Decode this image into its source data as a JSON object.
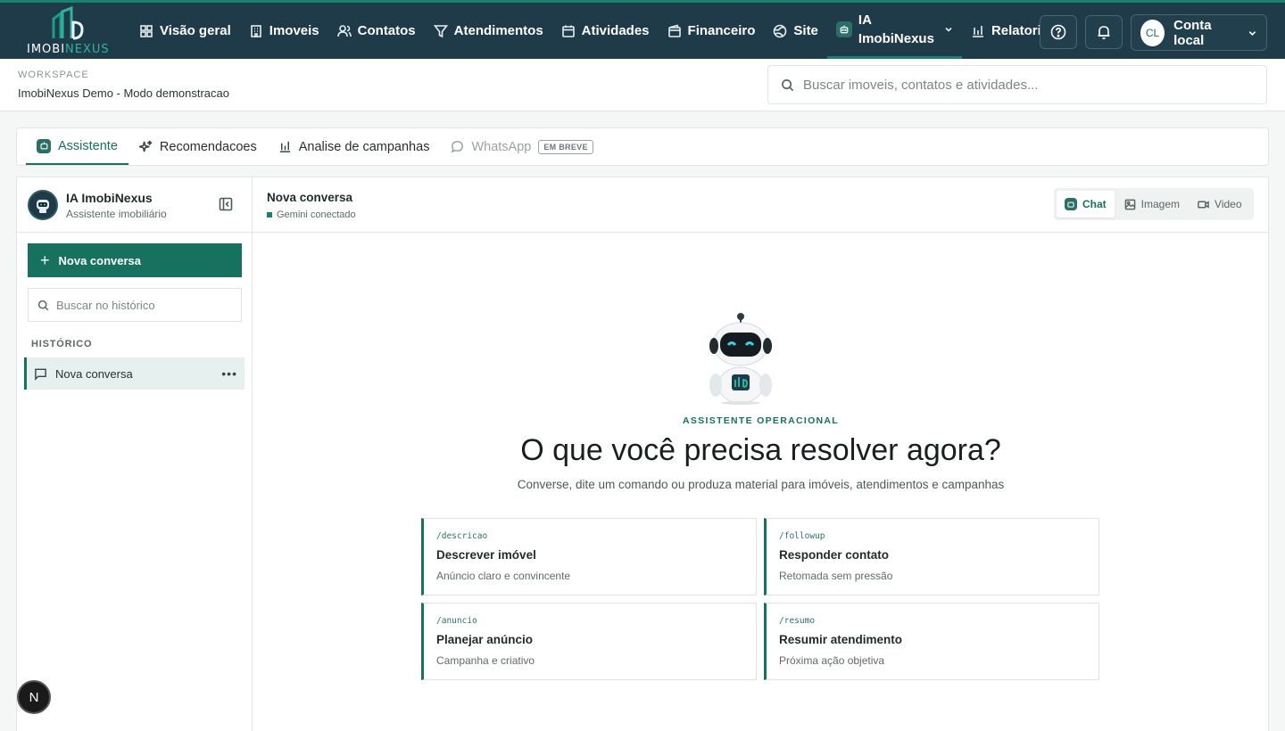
{
  "brand": {
    "word_a": "IMOBI",
    "word_b": "NEXUS"
  },
  "nav": {
    "items": [
      {
        "label": "Visão geral",
        "icon": "grid-icon"
      },
      {
        "label": "Imoveis",
        "icon": "building-icon"
      },
      {
        "label": "Contatos",
        "icon": "users-icon"
      },
      {
        "label": "Atendimentos",
        "icon": "filter-icon"
      },
      {
        "label": "Atividades",
        "icon": "calendar-icon"
      },
      {
        "label": "Financeiro",
        "icon": "wallet-icon"
      },
      {
        "label": "Site",
        "icon": "globe-icon"
      },
      {
        "label_line1": "IA",
        "label_line2": "ImobiNexus",
        "icon": "bot-icon"
      },
      {
        "label": "Relatorios",
        "icon": "bar-chart-icon"
      }
    ],
    "account": {
      "initials": "CL",
      "label": "Conta local"
    }
  },
  "workspace": {
    "label": "WORKSPACE",
    "name": "ImobiNexus Demo - Modo demonstracao",
    "search_placeholder": "Buscar imoveis, contatos e atividades..."
  },
  "tabs": {
    "assistente": "Assistente",
    "recomendacoes": "Recomendacoes",
    "analise": "Analise de campanhas",
    "whatsapp": "WhatsApp",
    "whatsapp_badge": "EM BREVE"
  },
  "sidebar": {
    "title": "IA ImobiNexus",
    "subtitle": "Assistente imobiliário",
    "new_button": "Nova conversa",
    "search_placeholder": "Buscar no histórico",
    "history_label": "HISTÓRICO",
    "history_items": [
      {
        "label": "Nova conversa"
      }
    ]
  },
  "chat": {
    "title": "Nova conversa",
    "status": "Gemini conectado",
    "modes": {
      "chat": "Chat",
      "imagem": "Imagem",
      "video": "Video"
    }
  },
  "hero": {
    "eyebrow": "ASSISTENTE OPERACIONAL",
    "title": "O que você precisa resolver agora?",
    "subtitle": "Converse, dite um comando ou produza material para imóveis, atendimentos e campanhas",
    "cards": [
      {
        "cmd": "/descricao",
        "title": "Descrever imóvel",
        "sub": "Anúncio claro e convincente"
      },
      {
        "cmd": "/followup",
        "title": "Responder contato",
        "sub": "Retomada sem pressão"
      },
      {
        "cmd": "/anuncio",
        "title": "Planejar anúncio",
        "sub": "Campanha e criativo"
      },
      {
        "cmd": "/resumo",
        "title": "Resumir atendimento",
        "sub": "Próxima ação objetiva"
      }
    ]
  },
  "dev_badge": "N",
  "colors": {
    "nav_bg": "#1f3a48",
    "accent": "#16715f",
    "accent_light": "#e6f1ef"
  }
}
